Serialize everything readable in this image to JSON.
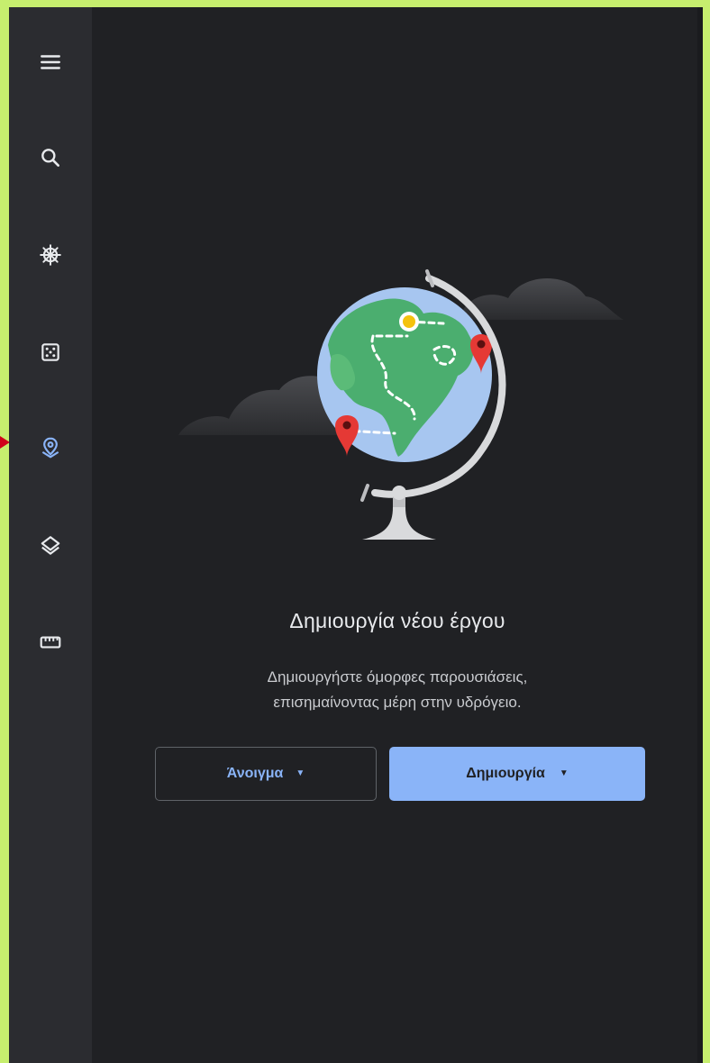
{
  "sidebar": {
    "items": [
      {
        "icon": "menu-icon"
      },
      {
        "icon": "search-icon"
      },
      {
        "icon": "ships-wheel-icon"
      },
      {
        "icon": "dice-icon"
      },
      {
        "icon": "projects-pin-icon",
        "active": true
      },
      {
        "icon": "layers-icon"
      },
      {
        "icon": "ruler-icon"
      }
    ]
  },
  "empty_state": {
    "title": "Δημιουργία νέου έργου",
    "description_line1": "Δημιουργήστε όμορφες παρουσιάσεις,",
    "description_line2": "επισημαίνοντας μέρη στην υδρόγειο.",
    "open_button_label": "Άνοιγμα",
    "create_button_label": "Δημιουργία",
    "caret": "▼"
  },
  "colors": {
    "background": "#202124",
    "sidebar": "#2b2c30",
    "accent": "#8ab4f8",
    "border": "#c6ee6e"
  }
}
